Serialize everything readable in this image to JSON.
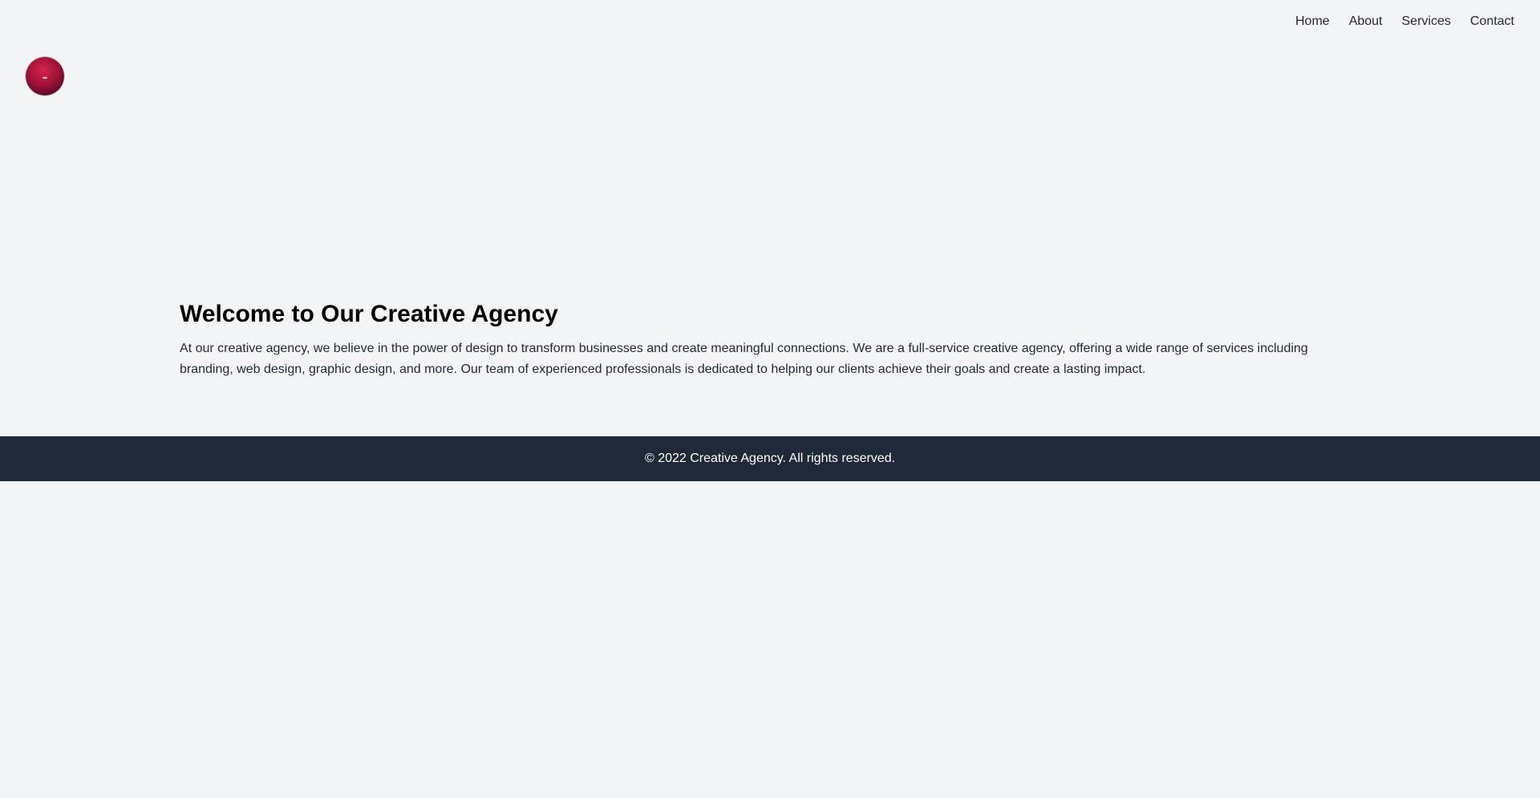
{
  "nav": {
    "items": [
      {
        "label": "Home"
      },
      {
        "label": "About"
      },
      {
        "label": "Services"
      },
      {
        "label": "Contact"
      }
    ]
  },
  "logo": {
    "icon": "red-sphere-logo",
    "color": "#9f1239"
  },
  "hero": {
    "title": "Welcome to Our Creative Agency",
    "body": "At our creative agency, we believe in the power of design to transform businesses and create meaningful connections. We are a full-service creative agency, offering a wide range of services including branding, web design, graphic design, and more. Our team of experienced professionals is dedicated to helping our clients achieve their goals and create a lasting impact."
  },
  "footer": {
    "text": "© 2022 Creative Agency. All rights reserved.",
    "background": "#1f2937"
  }
}
